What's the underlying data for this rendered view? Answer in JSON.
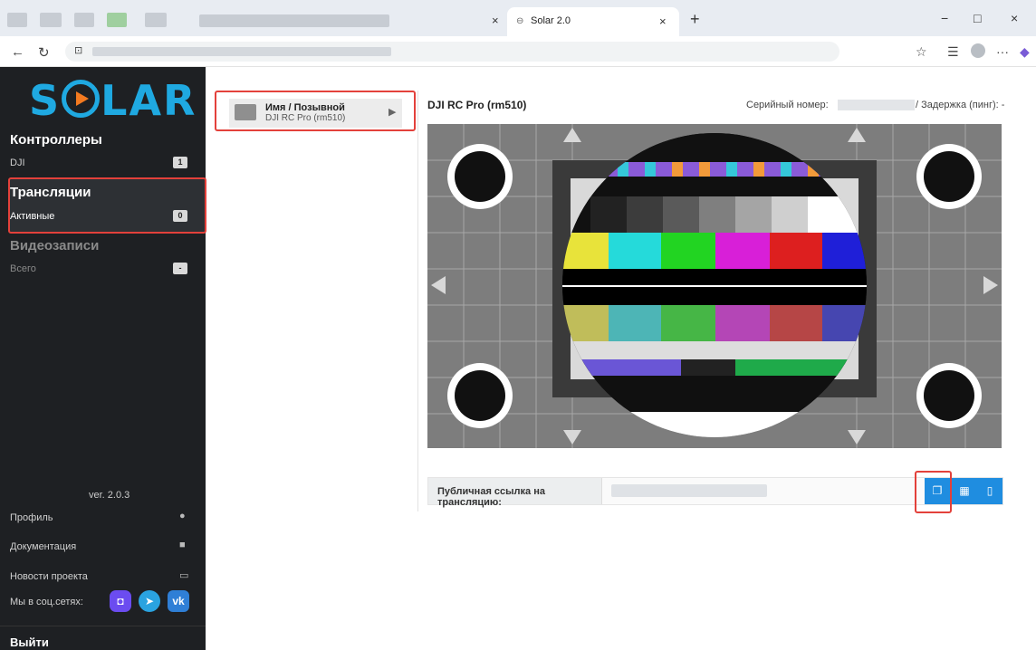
{
  "browser": {
    "tab_title": "Solar 2.0",
    "tab_icon": "link-icon",
    "new_tab": "+",
    "close_glyph": "×",
    "window_controls": {
      "minimize": "−",
      "maximize": "□",
      "close": "×"
    }
  },
  "sidebar": {
    "logo": {
      "left": "S",
      "right": "LAR"
    },
    "controllers": {
      "title": "Контроллеры",
      "item_label": "DJI",
      "item_count": "1"
    },
    "streams": {
      "title": "Трансляции",
      "item_label": "Активные",
      "item_count": "0"
    },
    "recordings": {
      "title": "Видеозаписи",
      "item_label": "Всего",
      "item_count": "-"
    },
    "version": "ver. 2.0.3",
    "menu": {
      "profile": "Профиль",
      "docs": "Документация",
      "news": "Новости проекта",
      "social": "Мы в соц.сетях:"
    },
    "social_buttons": {
      "max": "◘",
      "telegram": "➤",
      "vk": "vk"
    },
    "logout": "Выйти"
  },
  "stream_list": [
    {
      "name": "Имя / Позывной",
      "device": "DJI RC Pro (rm510)"
    }
  ],
  "player": {
    "title": "DJI RC Pro (rm510)",
    "serial_label": "Серийный номер:",
    "ping_label": "/ Задержка (пинг): -",
    "public_link_label": "Публичная ссылка на трансляцию:"
  },
  "colors": {
    "accent": "#1f8de0",
    "highlight": "#e3413b",
    "sidebar_bg": "#1e2023",
    "logo": "#1fa9e1",
    "logo_play": "#f47a20"
  }
}
